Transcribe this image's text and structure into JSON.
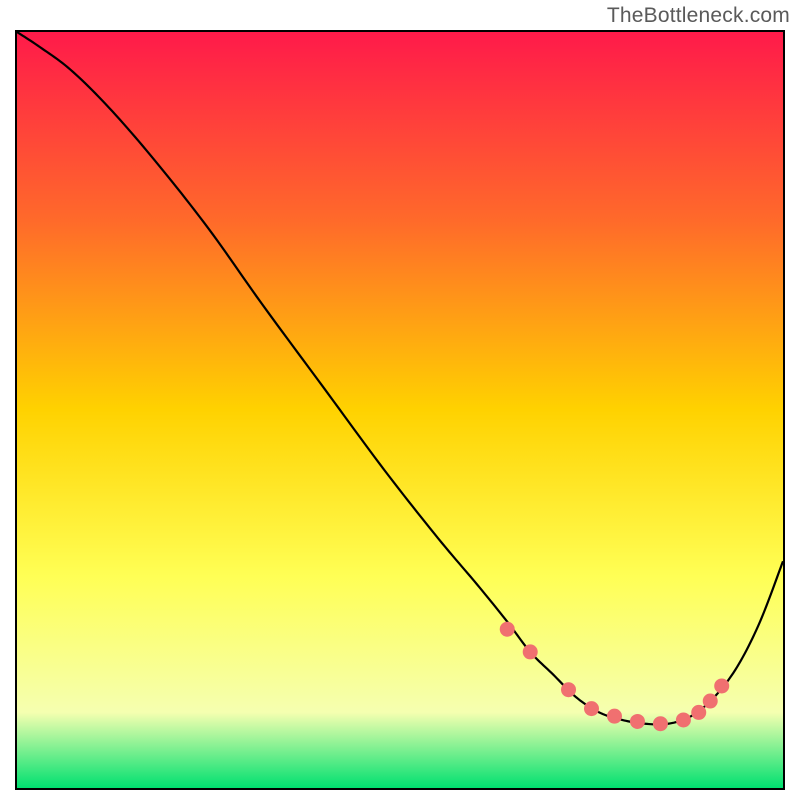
{
  "watermark": "TheBottleneck.com",
  "colors": {
    "gradient_top": "#ff1a4a",
    "gradient_mid_upper": "#ff6a2a",
    "gradient_mid": "#ffd200",
    "gradient_mid_lower": "#ffff55",
    "gradient_lower": "#f5ffb0",
    "gradient_bottom": "#00e070",
    "line": "#000000",
    "marker": "#f07070",
    "border": "#000000"
  },
  "chart_data": {
    "type": "line",
    "title": "",
    "xlabel": "",
    "ylabel": "",
    "xlim": [
      0,
      100
    ],
    "ylim": [
      0,
      100
    ],
    "series": [
      {
        "name": "curve",
        "x": [
          0,
          3,
          7,
          12,
          18,
          25,
          32,
          40,
          48,
          55,
          60,
          64,
          67,
          70,
          73,
          76,
          79,
          82,
          85,
          88,
          91,
          94,
          97,
          100
        ],
        "y": [
          100,
          98,
          95,
          90,
          83,
          74,
          64,
          53,
          42,
          33,
          27,
          22,
          18,
          15,
          12,
          10,
          9,
          8.5,
          8.5,
          9.5,
          12,
          16,
          22,
          30
        ]
      }
    ],
    "markers": {
      "name": "highlight-points",
      "x": [
        64,
        67,
        72,
        75,
        78,
        81,
        84,
        87,
        89,
        90.5,
        92
      ],
      "y": [
        21,
        18,
        13,
        10.5,
        9.5,
        8.8,
        8.5,
        9,
        10,
        11.5,
        13.5
      ]
    }
  }
}
